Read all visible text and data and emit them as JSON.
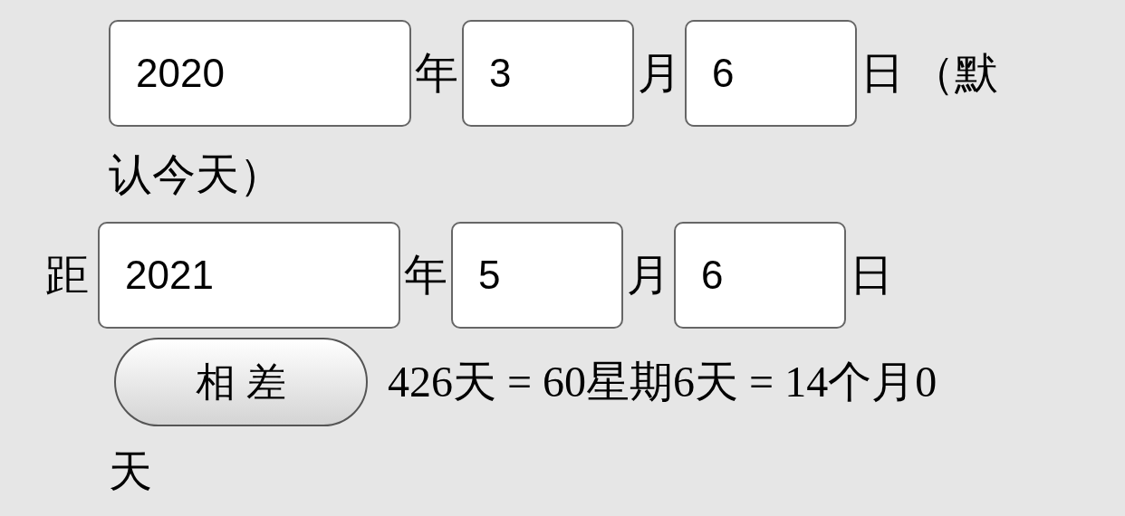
{
  "start": {
    "year": "2020",
    "year_unit": "年",
    "month": "3",
    "month_unit": "月",
    "day": "6",
    "day_unit": "日",
    "note_line_1": "（默",
    "note_line_2": "认今天）"
  },
  "end": {
    "prefix": "距",
    "year": "2021",
    "year_unit": "年",
    "month": "5",
    "month_unit": "月",
    "day": "6",
    "day_unit": "日"
  },
  "button": "相 差",
  "result_line_1": "426天 = 60星期6天 = 14个月0",
  "result_line_2": "天"
}
